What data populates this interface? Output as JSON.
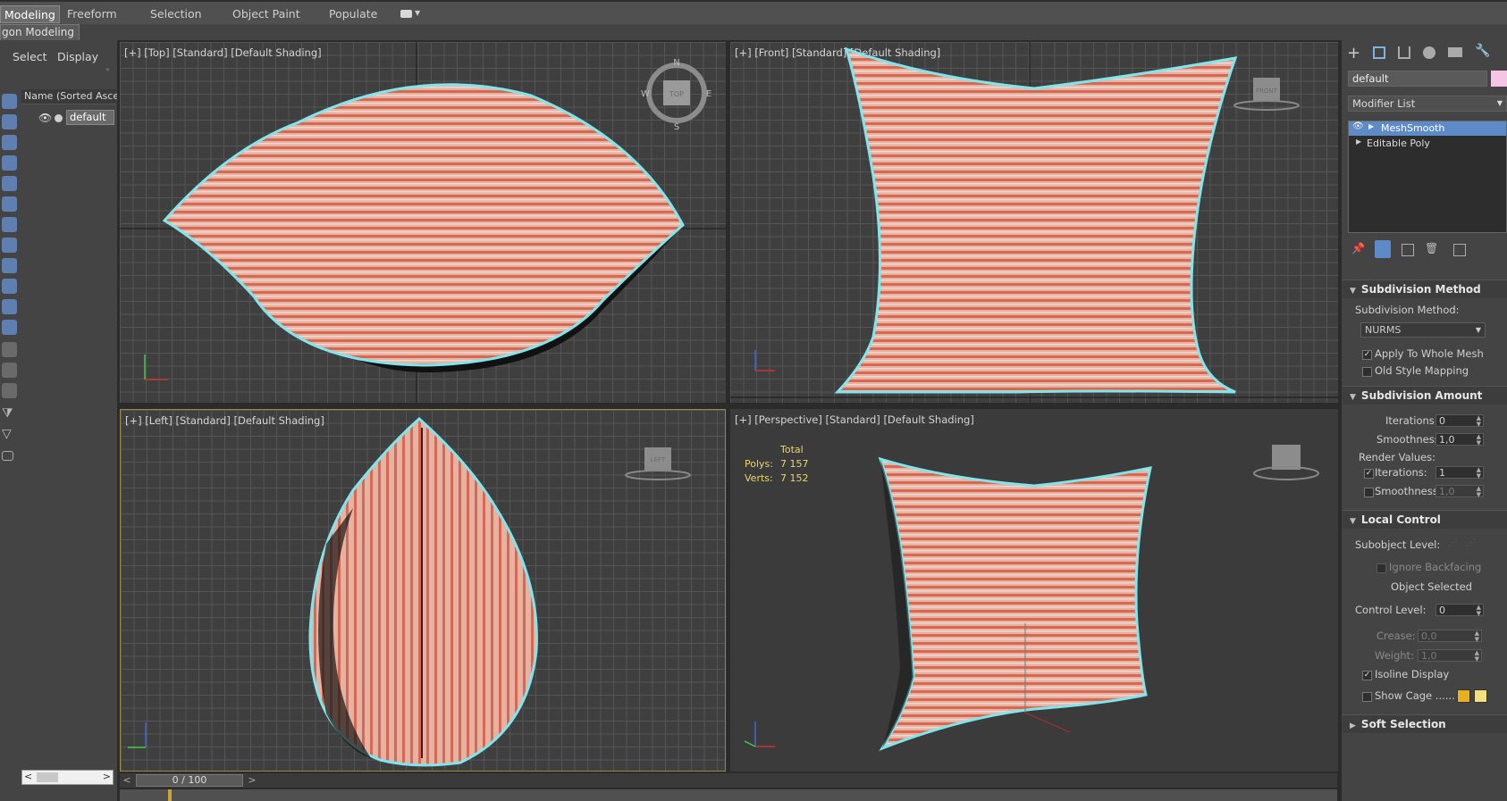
{
  "ribbon": {
    "tabs": [
      "Modeling",
      "Freeform",
      "Selection",
      "Object Paint",
      "Populate"
    ],
    "subtitle": "gon Modeling"
  },
  "explorer": {
    "menu": [
      "Select",
      "Display"
    ],
    "column_header": "Name (Sorted Ascen",
    "object_name": "default"
  },
  "viewports": {
    "top": "[+] [Top] [Standard] [Default Shading]",
    "front": "[+] [Front] [Standard] [Default Shading]",
    "left": "[+] [Left] [Standard] [Default Shading]",
    "perspective": "[+] [Perspective] [Standard] [Default Shading]",
    "compass": {
      "n": "N",
      "s": "S",
      "e": "E",
      "w": "W"
    },
    "viewcube_top": "TOP",
    "viewcube_front": "FRONT",
    "viewcube_left": "LEFT"
  },
  "stats": {
    "header": "Total",
    "polys_label": "Polys:",
    "polys_value": "7 157",
    "verts_label": "Verts:",
    "verts_value": "7 152"
  },
  "timeline": {
    "counter": "0 / 100",
    "prev": "<",
    "next": ">",
    "scroll_left": "<",
    "scroll_right": ">"
  },
  "command_panel": {
    "object_name": "default",
    "object_color": "#f4c6e4",
    "modifier_list": "Modifier List",
    "stack": [
      "MeshSmooth",
      "Editable Poly"
    ],
    "subdivision_method": {
      "title": "Subdivision Method",
      "label": "Subdivision Method:",
      "value": "NURMS",
      "apply_whole_mesh": "Apply To Whole Mesh",
      "old_style_mapping": "Old Style Mapping"
    },
    "subdivision_amount": {
      "title": "Subdivision Amount",
      "iterations_label": "Iterations:",
      "iterations_value": "0",
      "smoothness_label": "Smoothness:",
      "smoothness_value": "1,0",
      "render_values": "Render Values:",
      "render_iterations_label": "Iterations:",
      "render_iterations_value": "1",
      "render_smoothness_label": "Smoothness:",
      "render_smoothness_value": "1,0"
    },
    "local_control": {
      "title": "Local Control",
      "subobject_level": "Subobject Level:",
      "ignore_backfacing": "Ignore Backfacing",
      "object_selected": "Object Selected",
      "control_level_label": "Control Level:",
      "control_level_value": "0",
      "crease_label": "Crease:",
      "crease_value": "0,0",
      "weight_label": "Weight:",
      "weight_value": "1,0",
      "isoline_display": "Isoline Display",
      "show_cage": "Show Cage ......",
      "cage_color_1": "#e8b020",
      "cage_color_2": "#f0e080"
    },
    "soft_selection": {
      "title": "Soft Selection"
    }
  }
}
